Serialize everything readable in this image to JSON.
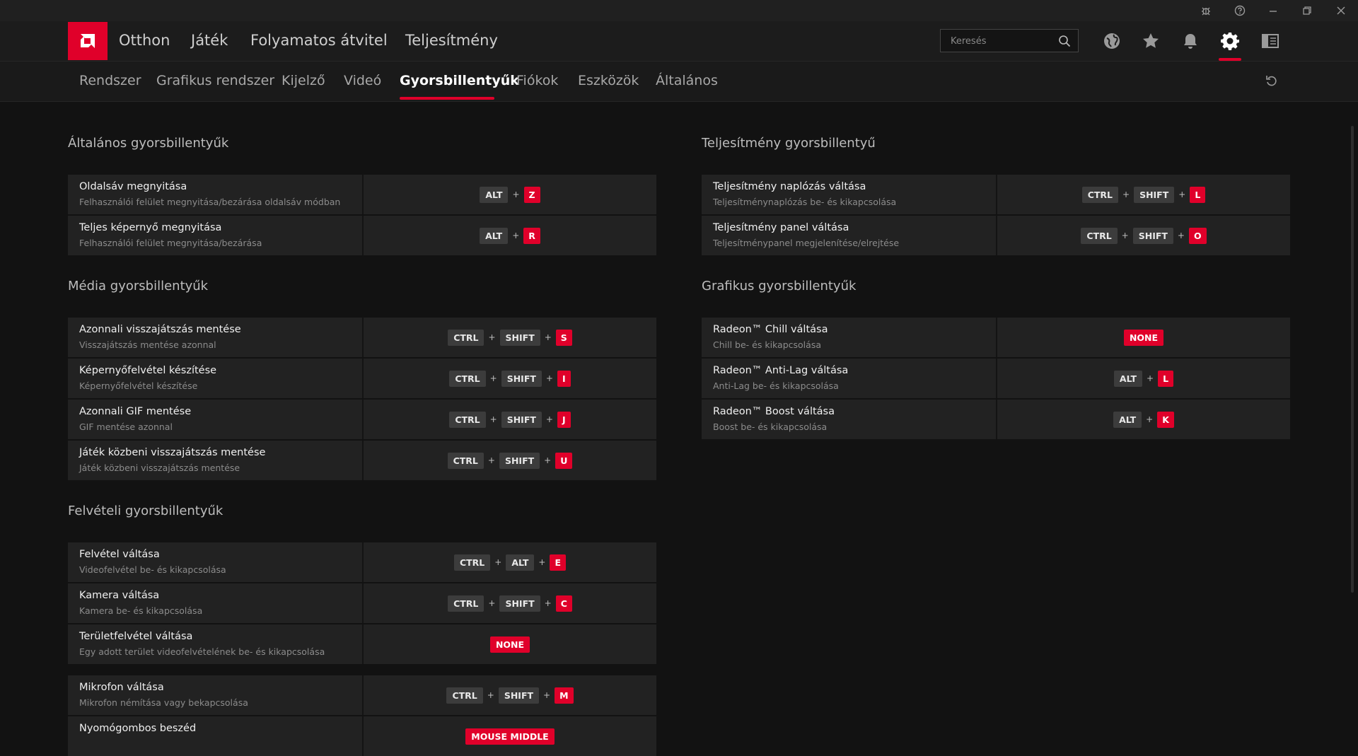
{
  "titlebar": {
    "icons": [
      "bug-icon",
      "help-icon",
      "minimize-icon",
      "restore-icon",
      "close-icon"
    ]
  },
  "nav": {
    "items": [
      "Otthon",
      "Játék",
      "Folyamatos átvitel",
      "Teljesítmény"
    ],
    "search_placeholder": "Keresés",
    "icons": [
      "globe-icon",
      "star-icon",
      "bell-icon",
      "gear-icon",
      "sidebar-icon"
    ],
    "accent": "#e0002a"
  },
  "subnav": {
    "tabs": [
      "Rendszer",
      "Grafikus rendszer",
      "Kijelző",
      "Videó",
      "Gyorsbillentyűk",
      "Fiókok",
      "Eszközök",
      "Általános"
    ],
    "active": "Gyorsbillentyűk"
  },
  "left": {
    "general": {
      "title": "Általános gyorsbillentyűk",
      "rows": [
        {
          "title": "Oldalsáv megnyitása",
          "desc": "Felhasználói felület megnyitása/bezárása oldalsáv módban",
          "keys": [
            "ALT",
            "Z"
          ]
        },
        {
          "title": "Teljes képernyő megnyitása",
          "desc": "Felhasználói felület megnyitása/bezárása",
          "keys": [
            "ALT",
            "R"
          ]
        }
      ]
    },
    "media": {
      "title": "Média gyorsbillentyűk",
      "rows": [
        {
          "title": "Azonnali visszajátszás mentése",
          "desc": "Visszajátszás mentése azonnal",
          "keys": [
            "CTRL",
            "SHIFT",
            "S"
          ]
        },
        {
          "title": "Képernyőfelvétel készítése",
          "desc": "Képernyőfelvétel készítése",
          "keys": [
            "CTRL",
            "SHIFT",
            "I"
          ]
        },
        {
          "title": "Azonnali GIF mentése",
          "desc": "GIF mentése azonnal",
          "keys": [
            "CTRL",
            "SHIFT",
            "J"
          ]
        },
        {
          "title": "Játék közbeni visszajátszás mentése",
          "desc": "Játék közbeni visszajátszás mentése",
          "keys": [
            "CTRL",
            "SHIFT",
            "U"
          ]
        }
      ]
    },
    "recording": {
      "title": "Felvételi gyorsbillentyűk",
      "rows": [
        {
          "title": "Felvétel váltása",
          "desc": "Videofelvétel be- és kikapcsolása",
          "keys": [
            "CTRL",
            "ALT",
            "E"
          ]
        },
        {
          "title": "Kamera váltása",
          "desc": "Kamera be- és kikapcsolása",
          "keys": [
            "CTRL",
            "SHIFT",
            "C"
          ]
        },
        {
          "title": "Területfelvétel váltása",
          "desc": "Egy adott terület videofelvételének be- és kikapcsolása",
          "keys": [
            "NONE"
          ]
        }
      ],
      "rows2": [
        {
          "title": "Mikrofon váltása",
          "desc": "Mikrofon némítása vagy bekapcsolása",
          "keys": [
            "CTRL",
            "SHIFT",
            "M"
          ]
        },
        {
          "title": "Nyomógombos beszéd",
          "desc": "",
          "keys": [
            "MOUSE MIDDLE"
          ]
        }
      ]
    }
  },
  "right": {
    "performance": {
      "title": "Teljesítmény gyorsbillentyű",
      "rows": [
        {
          "title": "Teljesítmény naplózás váltása",
          "desc": "Teljesítménynaplózás be- és kikapcsolása",
          "keys": [
            "CTRL",
            "SHIFT",
            "L"
          ]
        },
        {
          "title": "Teljesítmény panel váltása",
          "desc": "Teljesítménypanel megjelenítése/elrejtése",
          "keys": [
            "CTRL",
            "SHIFT",
            "O"
          ]
        }
      ]
    },
    "graphics": {
      "title": "Grafikus gyorsbillentyűk",
      "rows": [
        {
          "title": "Radeon™ Chill váltása",
          "desc": "Chill be- és kikapcsolása",
          "keys": [
            "NONE"
          ]
        },
        {
          "title": "Radeon™ Anti-Lag váltása",
          "desc": "Anti-Lag be- és kikapcsolása",
          "keys": [
            "ALT",
            "L"
          ]
        },
        {
          "title": "Radeon™ Boost váltása",
          "desc": "Boost be- és kikapcsolása",
          "keys": [
            "ALT",
            "K"
          ]
        }
      ]
    }
  }
}
